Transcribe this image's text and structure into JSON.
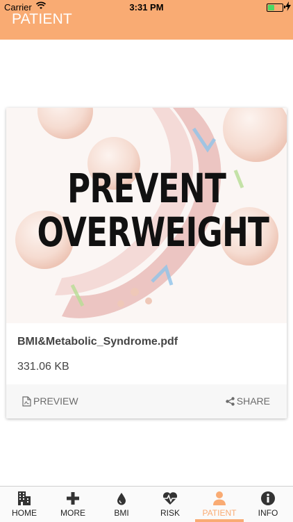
{
  "status": {
    "carrier": "Carrier",
    "time": "3:31 PM"
  },
  "header": {
    "title": "PATIENT"
  },
  "card": {
    "image_text_line1": "PREVENT",
    "image_text_line2": "OVERWEIGHT",
    "filename": "BMI&Metabolic_Syndrome.pdf",
    "filesize": "331.06 KB",
    "preview_label": "PREVIEW",
    "share_label": "SHARE"
  },
  "tabs": [
    {
      "label": "HOME",
      "icon": "building-icon"
    },
    {
      "label": "MORE",
      "icon": "plus-icon"
    },
    {
      "label": "BMI",
      "icon": "drop-icon"
    },
    {
      "label": "RISK",
      "icon": "heartbeat-icon"
    },
    {
      "label": "PATIENT",
      "icon": "person-icon",
      "active": true
    },
    {
      "label": "INFO",
      "icon": "info-icon"
    }
  ],
  "colors": {
    "accent": "#f9ab73",
    "battery": "#4cd964"
  }
}
